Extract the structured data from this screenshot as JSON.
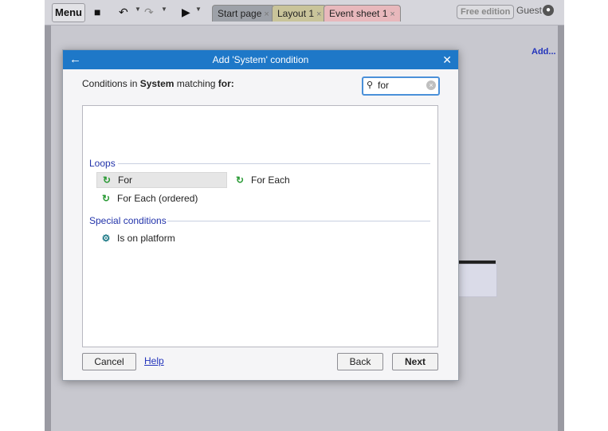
{
  "toolbar": {
    "menu_label": "Menu",
    "icons": {
      "save": "save-icon",
      "undo": "undo-icon",
      "redo": "redo-icon",
      "run": "play-icon",
      "user": "user-circle-icon"
    },
    "tabs": [
      {
        "label": "Start page"
      },
      {
        "label": "Layout 1"
      },
      {
        "label": "Event sheet 1"
      }
    ],
    "edition_badge": "Free edition",
    "user_label": "Guest"
  },
  "background": {
    "add_link": "Add..."
  },
  "dialog": {
    "title": "Add 'System' condition",
    "heading_prefix": "Conditions in ",
    "heading_object": "System",
    "heading_mid": " matching ",
    "heading_term": "for:",
    "search": {
      "value": "for"
    },
    "groups": [
      {
        "label": "Loops",
        "items": [
          {
            "label": "For",
            "icon": "loop-icon",
            "selected": true
          },
          {
            "label": "For Each",
            "icon": "loop-icon",
            "selected": false
          },
          {
            "label": "For Each (ordered)",
            "icon": "loop-icon",
            "selected": false
          }
        ]
      },
      {
        "label": "Special conditions",
        "items": [
          {
            "label": "Is on platform",
            "icon": "gear-icon",
            "selected": false
          }
        ]
      }
    ],
    "buttons": {
      "cancel": "Cancel",
      "help": "Help",
      "back": "Back",
      "next": "Next"
    }
  },
  "colors": {
    "accent": "#1e78c8",
    "link": "#2233bb",
    "loop_icon": "#2a9a35",
    "gear_icon": "#1f7a87"
  }
}
